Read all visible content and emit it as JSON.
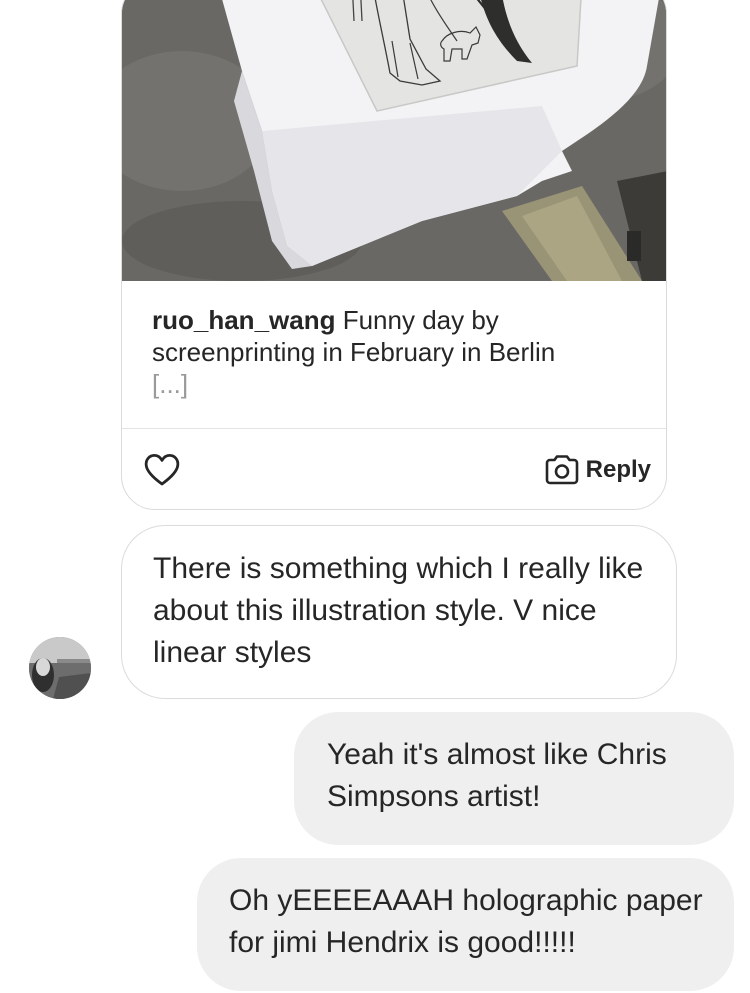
{
  "shared_post": {
    "username": "ruo_han_wang",
    "caption": " Funny day by screenprinting in February in Berlin",
    "more_label": "[...]",
    "reply_label": "Reply",
    "like_icon": "heart-outline-icon",
    "reply_icon": "camera-icon"
  },
  "messages": [
    {
      "direction": "received",
      "text": "There is something which I really like about this illustration style.  V nice linear styles"
    },
    {
      "direction": "sent",
      "text": "Yeah it's almost like Chris Simpsons artist!"
    },
    {
      "direction": "sent",
      "text": "Oh yEEEEAAAH holographic paper for jimi Hendrix is good!!!!!"
    }
  ],
  "colors": {
    "sent_bubble": "#efefef",
    "received_border": "#dbdbdb",
    "text": "#262626",
    "muted": "#9a9a9a"
  }
}
